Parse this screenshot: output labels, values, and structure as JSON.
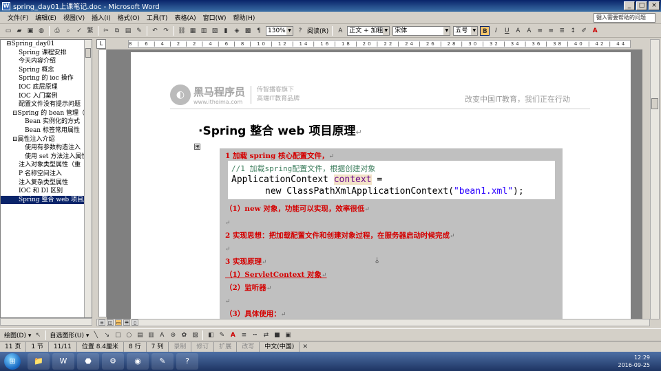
{
  "window": {
    "title": "spring_day01上课笔记.doc - Microsoft Word",
    "min": "_",
    "max": "□",
    "close": "×"
  },
  "menu": {
    "items": [
      "文件(F)",
      "编辑(E)",
      "视图(V)",
      "插入(I)",
      "格式(O)",
      "工具(T)",
      "表格(A)",
      "窗口(W)",
      "帮助(H)"
    ],
    "help_box": "键入需要帮助的问题"
  },
  "toolbar": {
    "zoom": "130%",
    "read_label": "阅读(R)",
    "style": "正文 + 加粗",
    "font": "宋体",
    "size": "五号",
    "bold": "B",
    "italic": "I",
    "underline": "U"
  },
  "docmap": {
    "items": [
      {
        "label": "⊟Spring_day01",
        "indent": 0
      },
      {
        "label": "Spring 课程安排",
        "indent": 1
      },
      {
        "label": "今天内容介绍",
        "indent": 1
      },
      {
        "label": "Spring 概念",
        "indent": 1
      },
      {
        "label": "Spring 的 ioc 操作",
        "indent": 1
      },
      {
        "label": "IOC 底层原理",
        "indent": 1
      },
      {
        "label": "IOC 入门案例",
        "indent": 1
      },
      {
        "label": "配置文件没有提示问题",
        "indent": 1
      },
      {
        "label": "⊟Spring 的 bean 管理（x",
        "indent": 0.5
      },
      {
        "label": "Bean 实例化的方式",
        "indent": 2
      },
      {
        "label": "Bean 标签常用属性",
        "indent": 2
      },
      {
        "label": "⊟属性注入介绍",
        "indent": 0.5
      },
      {
        "label": "使用有参数构造注入",
        "indent": 2
      },
      {
        "label": "使用 set 方法注入属性",
        "indent": 2
      },
      {
        "label": "注入对象类型属性（重",
        "indent": 1
      },
      {
        "label": "P 名称空间注入",
        "indent": 1
      },
      {
        "label": "注入复杂类型属性",
        "indent": 1
      },
      {
        "label": "IOC 和 DI 区别",
        "indent": 1
      },
      {
        "label": "Spring 整合 web 项目原",
        "indent": 1,
        "selected": true
      }
    ]
  },
  "ruler": {
    "ticks": "8 | 6 | 4 | 2 | 2 | 4 | 6 | 8 | 10 | 12 | 14 | 16 | 18 | 20 | 22 | 24 | 26 | 28 | 30 | 32 | 34 | 36 | 38 | 40 | 42 | 44 | 46 | 48"
  },
  "header": {
    "logo_mark": "◐",
    "logo_main": "黑马程序员",
    "logo_url": "www.itheima.com",
    "logo_sub1": "传智播客旗下",
    "logo_sub2": "高端IT教育品牌",
    "slogan": "改变中国IT教育，我们正在行动"
  },
  "doc": {
    "heading": "·Spring 整合 web 项目原理",
    "para_mark": "↵",
    "anchor": "⊞",
    "line1": "1  加载 spring 核心配置文件，",
    "code": {
      "comment": "//1 加载spring配置文件，根据创建对象",
      "l2_a": "ApplicationContext ",
      "l2_var": "context",
      "l2_b": " =",
      "l3_a": "new ClassPathXmlApplicationContext(",
      "l3_str": "\"bean1.xml\"",
      "l3_b": ");"
    },
    "line2": "（1）new 对象，功能可以实现，效率很低",
    "line3": "2  实现思想：把加载配置文件和创建对象过程，在服务器启动时候完成",
    "line4": "3  实现原理",
    "line5": "（1）ServletContext 对象",
    "line6": "（2）监听器",
    "line7": "（3）具体使用：",
    "cursor": "⫰"
  },
  "drawbar": {
    "draw_label": "绘图(D) ▾",
    "autoshape_label": "自选图形(U) ▾"
  },
  "status": {
    "page": "11 页",
    "section": "1 节",
    "count": "11/11",
    "position": "位置 8.4厘米",
    "row": "8 行",
    "col": "7 列",
    "rec": "录制",
    "trk": "修订",
    "ext": "扩展",
    "ovr": "改写",
    "lang": "中文(中国)"
  },
  "taskbar": {
    "start": "⊞",
    "icons": [
      "📁",
      "W",
      "⬣",
      "⚙",
      "◉",
      "✎",
      "?"
    ],
    "time": "12:29",
    "date": "2016-09-25"
  }
}
